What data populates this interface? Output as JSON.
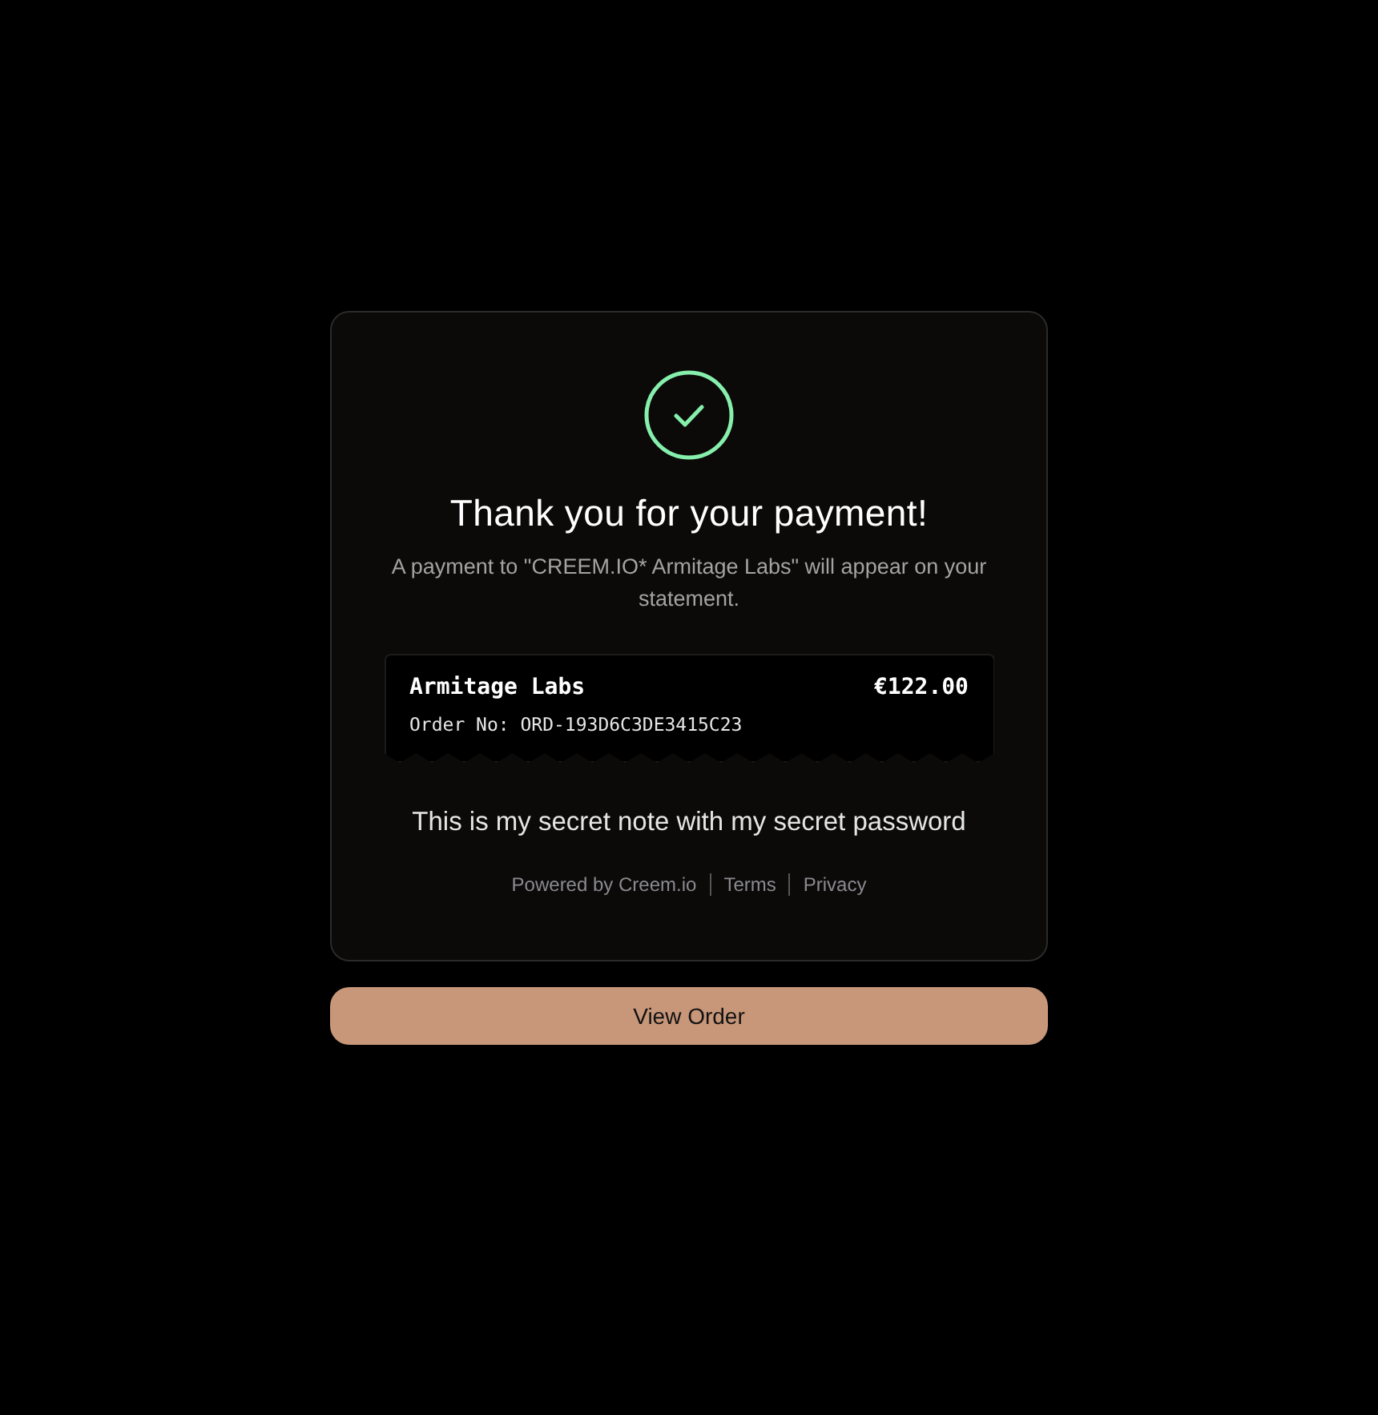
{
  "title": "Thank you for your payment!",
  "message": "A payment to \"CREEM.IO* Armitage Labs\" will appear on your statement.",
  "receipt": {
    "merchant": "Armitage Labs",
    "amount": "€122.00",
    "order": "Order No: ORD-193D6C3DE3415C23"
  },
  "note": "This is my secret note with my secret password",
  "footer_links": [
    "Powered by Creem.io",
    "Terms",
    "Privacy"
  ],
  "button": "View Order"
}
